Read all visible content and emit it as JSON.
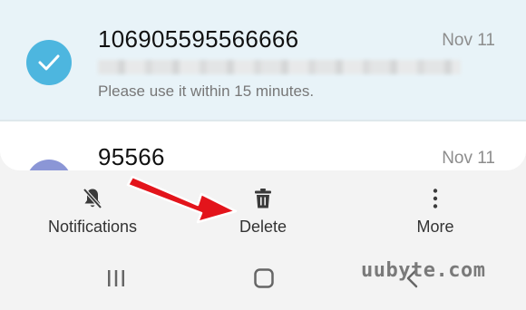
{
  "messages": [
    {
      "sender": "106905595566666",
      "date": "Nov 11",
      "preview": "Please use it within 15 minutes.",
      "selected": true,
      "icon": "check-icon"
    },
    {
      "sender": "95566",
      "date": "Nov 11",
      "selected": false,
      "icon": "avatar"
    }
  ],
  "actions": {
    "notifications": {
      "label": "Notifications",
      "icon": "bell-off-icon"
    },
    "delete": {
      "label": "Delete",
      "icon": "trash-icon"
    },
    "more": {
      "label": "More",
      "icon": "more-vertical-icon"
    }
  },
  "nav": {
    "recents_icon": "recents-icon",
    "home_icon": "home-icon",
    "back_icon": "back-icon"
  },
  "watermark": "uubyte.com",
  "colors": {
    "selected_row": "#e8f3f8",
    "accent": "#4db6df",
    "avatar": "#8b96d6",
    "arrow": "#e3141b",
    "background": "#f3f3f3"
  }
}
